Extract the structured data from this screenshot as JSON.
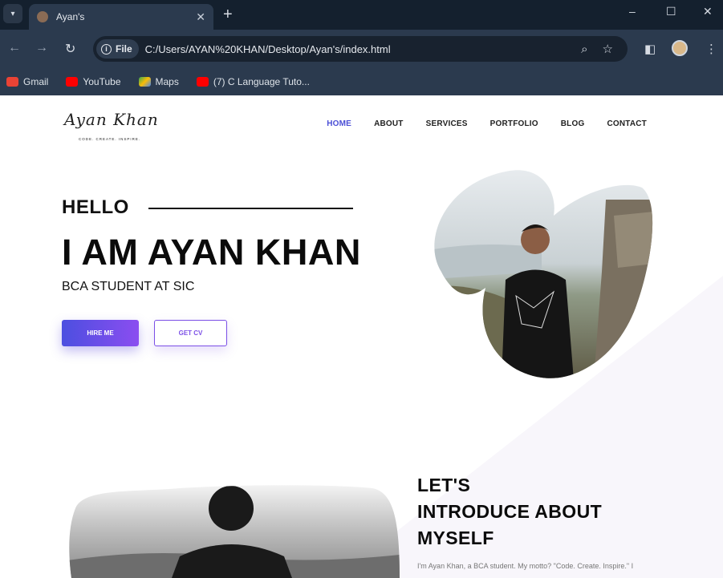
{
  "browser": {
    "tab_title": "Ayan's",
    "new_tab": "+",
    "address": {
      "scheme_label": "File",
      "url": "C:/Users/AYAN%20KHAN/Desktop/Ayan's/index.html"
    },
    "bookmarks": [
      {
        "label": "Gmail",
        "color": "#ea4335"
      },
      {
        "label": "YouTube",
        "color": "#ff0000"
      },
      {
        "label": "Maps",
        "color": "#34a853"
      },
      {
        "label": "(7) C Language Tuto...",
        "color": "#ff0000"
      }
    ],
    "window_controls": {
      "minimize": "–",
      "maximize": "☐",
      "close": "✕"
    }
  },
  "site": {
    "logo": {
      "signature": "Ayan Khan",
      "tagline": "CODE. CREATE. INSPIRE."
    },
    "nav": [
      {
        "label": "HOME",
        "active": true
      },
      {
        "label": "ABOUT",
        "active": false
      },
      {
        "label": "SERVICES",
        "active": false
      },
      {
        "label": "PORTFOLIO",
        "active": false
      },
      {
        "label": "BLOG",
        "active": false
      },
      {
        "label": "CONTACT",
        "active": false
      }
    ],
    "hero": {
      "greeting": "HELLO",
      "headline": "I AM AYAN KHAN",
      "subtitle": "BCA STUDENT AT SIC",
      "hire_button": "HIRE ME",
      "cv_button": "GET CV"
    },
    "about": {
      "title_lines": [
        "LET'S",
        "INTRODUCE ABOUT",
        "MYSELF"
      ],
      "text": "I'm Ayan Khan, a BCA student. My motto? \"Code. Create. Inspire.\" I"
    },
    "colors": {
      "accent": "#4b4fd6",
      "gradient_end": "#8b4df0",
      "chrome": "#2b3a4e"
    }
  }
}
